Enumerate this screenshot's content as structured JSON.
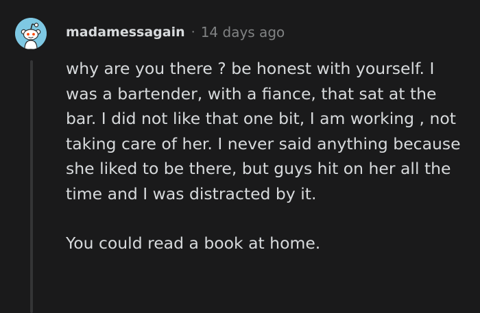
{
  "comment": {
    "author": "madamessagain",
    "separator": "·",
    "age": "14 days ago",
    "paragraphs": [
      "why are you there ? be honest with yourself. I was a bartender, with a fiance, that sat at the bar. I did not like that one bit, I am working , not taking care of her. I never said anything because she liked to be there, but guys hit on her all the time and I was distracted by it.",
      "You could read a book at home."
    ]
  },
  "avatar": {
    "icon": "snoo-avatar-icon",
    "background": "#7ec8e3"
  },
  "colors": {
    "background": "#1a1a1b",
    "text": "#d7dadc",
    "muted": "#818384",
    "thread_line": "#343536"
  }
}
